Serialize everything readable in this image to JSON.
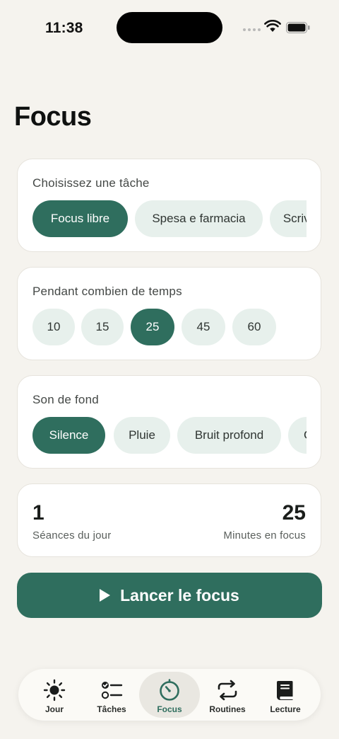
{
  "status": {
    "time": "11:38"
  },
  "page": {
    "title": "Focus"
  },
  "task_section": {
    "label": "Choisissez une tâche",
    "options": [
      "Focus libre",
      "Spesa e farmacia",
      "Scrivere"
    ],
    "selected": "Focus libre"
  },
  "duration_section": {
    "label": "Pendant combien de temps",
    "options": [
      "10",
      "15",
      "25",
      "45",
      "60"
    ],
    "selected": "25"
  },
  "sound_section": {
    "label": "Son de fond",
    "options": [
      "Silence",
      "Pluie",
      "Bruit profond",
      "Café"
    ],
    "selected": "Silence"
  },
  "stats": {
    "sessions_value": "1",
    "sessions_label": "Séances du jour",
    "minutes_value": "25",
    "minutes_label": "Minutes en focus"
  },
  "start_button": {
    "label": "Lancer le focus"
  },
  "tab_bar": {
    "tabs": [
      {
        "label": "Jour",
        "icon": "sun-icon"
      },
      {
        "label": "Tâches",
        "icon": "checklist-icon"
      },
      {
        "label": "Focus",
        "icon": "timer-icon"
      },
      {
        "label": "Routines",
        "icon": "repeat-icon"
      },
      {
        "label": "Lecture",
        "icon": "book-icon"
      }
    ],
    "active": "Focus"
  },
  "colors": {
    "accent": "#2f6e5e",
    "chip": "#e7f0ec",
    "background": "#f5f3ee"
  }
}
